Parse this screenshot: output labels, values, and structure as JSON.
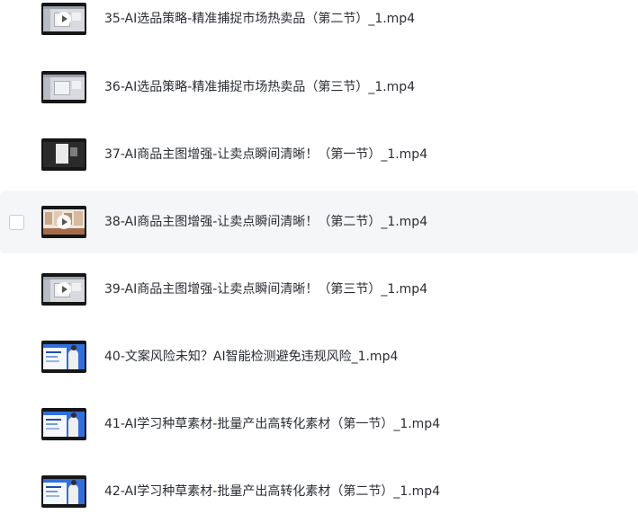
{
  "files": [
    {
      "name": "35-AI选品策略-精准捕捉市场热卖品（第二节）_1.mp4",
      "thumbnail_icon": "video-thumbnail-icon",
      "play_icon": "play-icon"
    },
    {
      "name": "36-AI选品策略-精准捕捉市场热卖品（第三节）_1.mp4",
      "thumbnail_icon": "video-thumbnail-icon"
    },
    {
      "name": "37-AI商品主图增强-让卖点瞬间清晰！（第一节）_1.mp4",
      "thumbnail_icon": "video-thumbnail-icon"
    },
    {
      "name": "38-AI商品主图增强-让卖点瞬间清晰！（第二节）_1.mp4",
      "thumbnail_icon": "video-thumbnail-icon",
      "play_icon": "play-icon",
      "state": "hovered"
    },
    {
      "name": "39-AI商品主图增强-让卖点瞬间清晰！（第三节）_1.mp4",
      "thumbnail_icon": "video-thumbnail-icon",
      "play_icon": "play-icon"
    },
    {
      "name": "40-文案风险未知？AI智能检测避免违规风险_1.mp4",
      "thumbnail_icon": "video-thumbnail-icon"
    },
    {
      "name": "41-AI学习种草素材-批量产出高转化素材（第一节）_1.mp4",
      "thumbnail_icon": "video-thumbnail-icon"
    },
    {
      "name": "42-AI学习种草素材-批量产出高转化素材（第二节）_1.mp4",
      "thumbnail_icon": "video-thumbnail-icon"
    }
  ],
  "colors": {
    "text": "#2a2d33",
    "hover_row_bg": "#f5f6f8",
    "checkbox_border": "#c9ccd3"
  }
}
